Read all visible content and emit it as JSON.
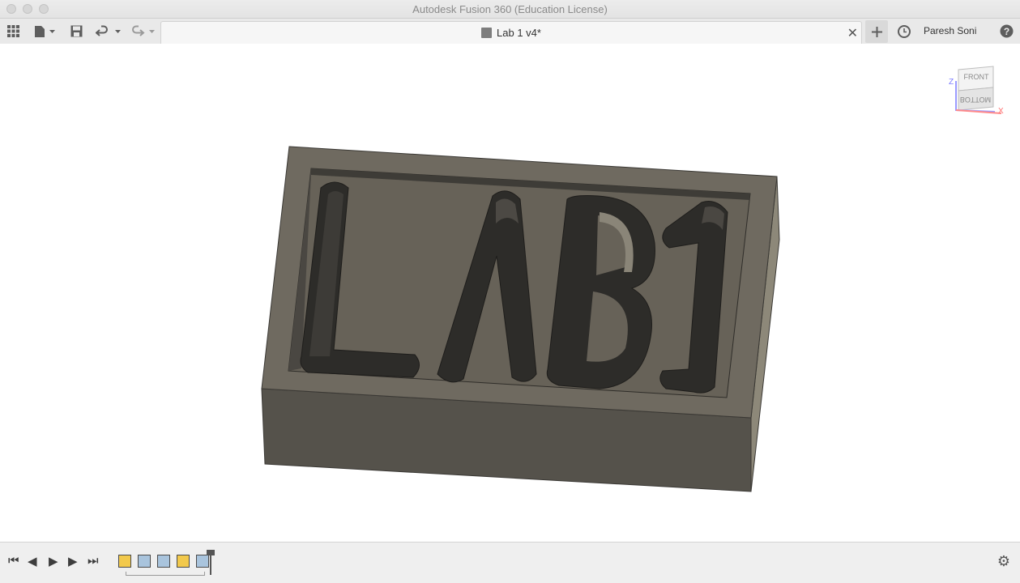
{
  "window": {
    "title": "Autodesk Fusion 360 (Education License)"
  },
  "toolbar": {
    "tab_title": "Lab 1 v4*",
    "user_name": "Paresh Soni",
    "icons": [
      "grid-icon",
      "file-icon",
      "save-icon",
      "undo-icon",
      "redo-icon",
      "plus-icon",
      "clock-icon",
      "help-icon"
    ]
  },
  "viewcube": {
    "front": "FRONT",
    "bottom": "BOTTOM",
    "axis_z": "Z",
    "axis_x": "X"
  },
  "timeline": {
    "features": [
      "sketch",
      "extrude",
      "extrude",
      "sketch",
      "extrude"
    ]
  },
  "colors": {
    "model_top": "#6e695f",
    "model_front": "#55524b",
    "model_side": "#8c877a",
    "cavity": "#2e2d2a"
  }
}
